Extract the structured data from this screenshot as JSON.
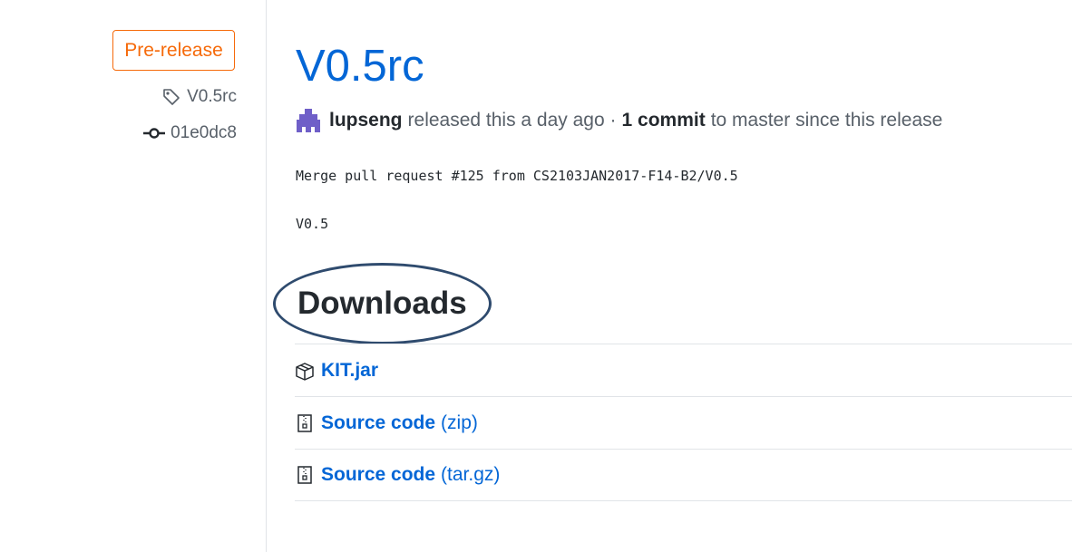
{
  "sidebar": {
    "badge": "Pre-release",
    "tag": "V0.5rc",
    "commit": "01e0dc8"
  },
  "release": {
    "title": "V0.5rc",
    "author": "lupseng",
    "released_text": "released this a day ago ·",
    "commit_count": "1 commit",
    "commit_suffix": "to master since this release",
    "body_line1": "Merge pull request #125 from CS2103JAN2017-F14-B2/V0.5",
    "body_line2": "V0.5"
  },
  "downloads": {
    "heading": "Downloads",
    "items": [
      {
        "name": "KIT.jar",
        "suffix": "",
        "icon": "package-icon"
      },
      {
        "name": "Source code",
        "suffix": "(zip)",
        "icon": "file-zip-icon"
      },
      {
        "name": "Source code",
        "suffix": "(tar.gz)",
        "icon": "file-zip-icon"
      }
    ]
  },
  "colors": {
    "link": "#0366d6",
    "prerelease": "#f66a0a",
    "annotation": "#2f4b6e"
  }
}
